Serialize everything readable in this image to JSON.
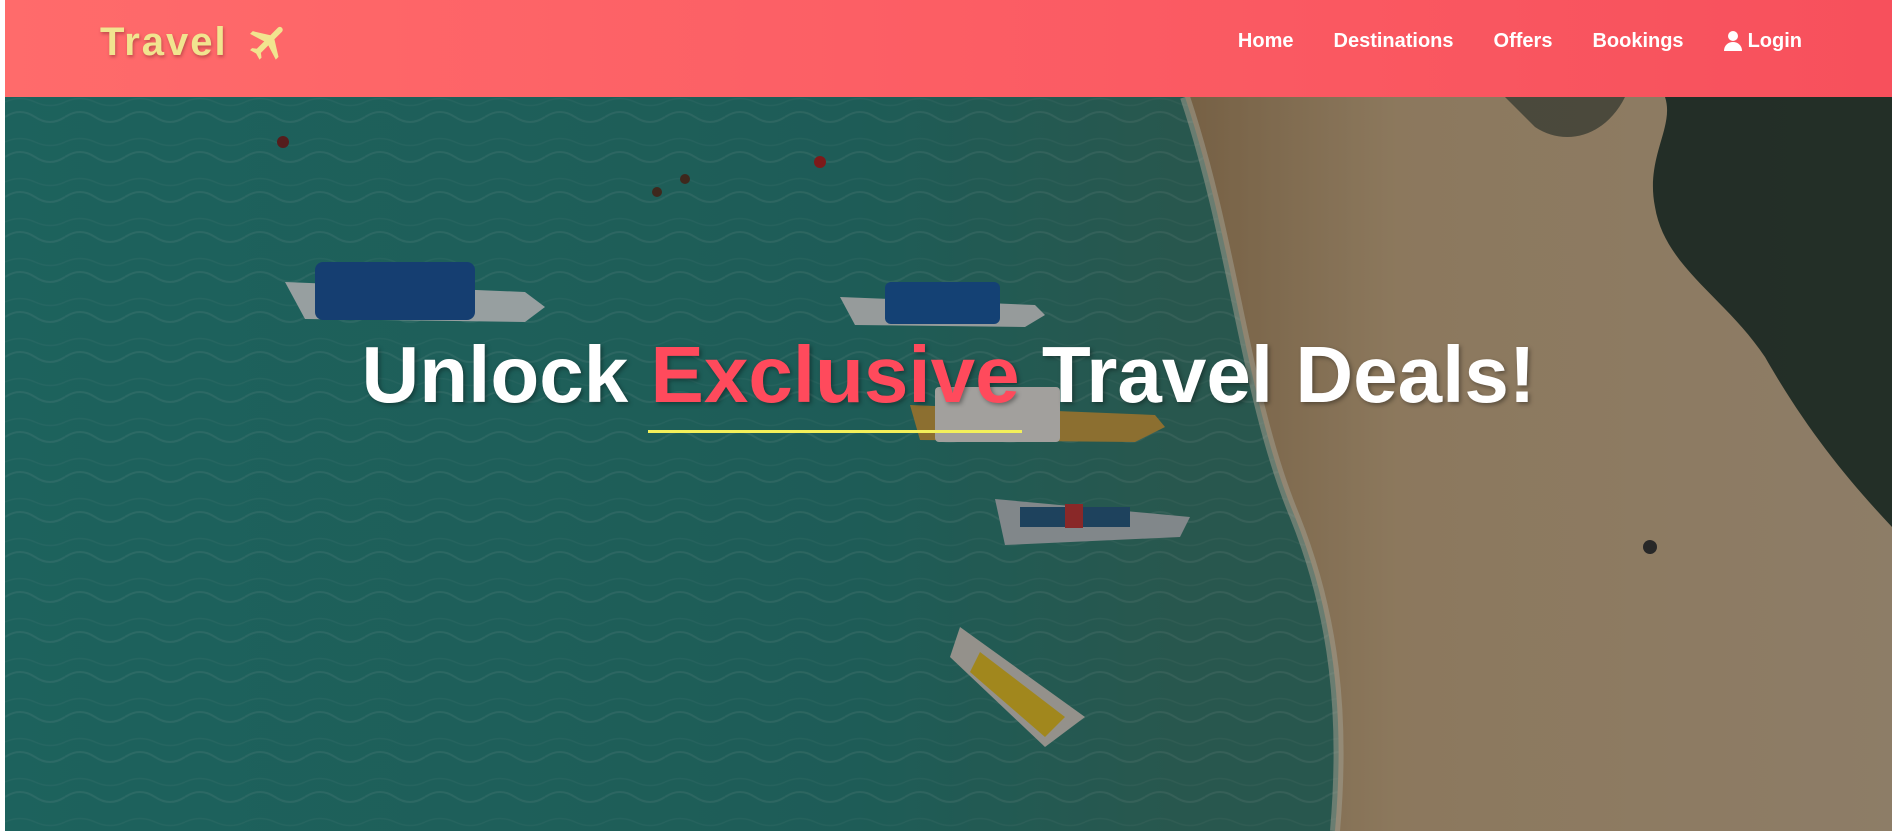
{
  "navbar": {
    "brand": "Travel",
    "brand_icon": "airplane-icon",
    "links": [
      {
        "label": "Home"
      },
      {
        "label": "Destinations"
      },
      {
        "label": "Offers"
      },
      {
        "label": "Bookings"
      },
      {
        "label": "Login",
        "icon": "user-icon"
      }
    ]
  },
  "hero": {
    "headline_before": "Unlock ",
    "headline_accent": "Exclusive",
    "headline_after": " Travel Deals!",
    "background": "aerial-beach-boats-photo"
  },
  "colors": {
    "navbar_start": "#ff6b6b",
    "navbar_end": "#f7505c",
    "brand_text": "#f1e48f",
    "accent_text": "#ff4a5c",
    "underline": "#f3f05a",
    "water": "#2f8f86",
    "sand": "#c8a880"
  }
}
